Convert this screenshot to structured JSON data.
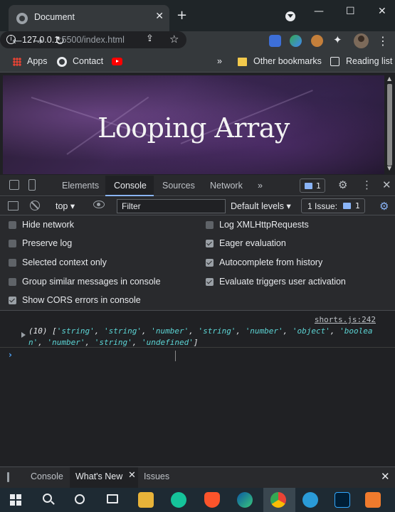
{
  "browser": {
    "tab_title": "Document",
    "tab_close": "✕",
    "new_tab": "+",
    "window_controls": {
      "minimize": "—",
      "maximize": "☐",
      "close": "✕"
    },
    "url_host": "127.0.0.1",
    "url_rest": ":5500/index.html",
    "bookmarks": {
      "apps": "Apps",
      "contact": "Contact",
      "overflow": "»",
      "other": "Other bookmarks",
      "reading_list": "Reading list"
    }
  },
  "page": {
    "heading": "Looping Array"
  },
  "devtools": {
    "tabs": [
      "Elements",
      "Console",
      "Sources",
      "Network"
    ],
    "more_tabs": "»",
    "message_count": "1",
    "context": "top ▾",
    "filter_placeholder": "Filter",
    "levels": "Default levels ▾",
    "issues_label": "1 Issue:",
    "issues_count": "1",
    "settings": {
      "left": [
        {
          "label": "Hide network",
          "checked": false
        },
        {
          "label": "Preserve log",
          "checked": false
        },
        {
          "label": "Selected context only",
          "checked": false
        },
        {
          "label": "Group similar messages in console",
          "checked": false
        },
        {
          "label": "Show CORS errors in console",
          "checked": true
        }
      ],
      "right": [
        {
          "label": "Log XMLHttpRequests",
          "checked": false
        },
        {
          "label": "Eager evaluation",
          "checked": true
        },
        {
          "label": "Autocomplete from history",
          "checked": true
        },
        {
          "label": "Evaluate triggers user activation",
          "checked": true
        }
      ]
    },
    "log": {
      "source": "shorts.js:242",
      "count": "(10)",
      "items": [
        "'string'",
        "'string'",
        "'number'",
        "'string'",
        "'number'",
        "'object'",
        "'boolean'",
        "'number'",
        "'string'",
        "'undefined'"
      ]
    },
    "prompt": "›",
    "drawer": {
      "tabs": [
        "Console",
        "What's New",
        "Issues"
      ],
      "close": "✕"
    }
  },
  "colors": {
    "string_value": "#5cd5d5",
    "accent": "#8ab4f8"
  }
}
